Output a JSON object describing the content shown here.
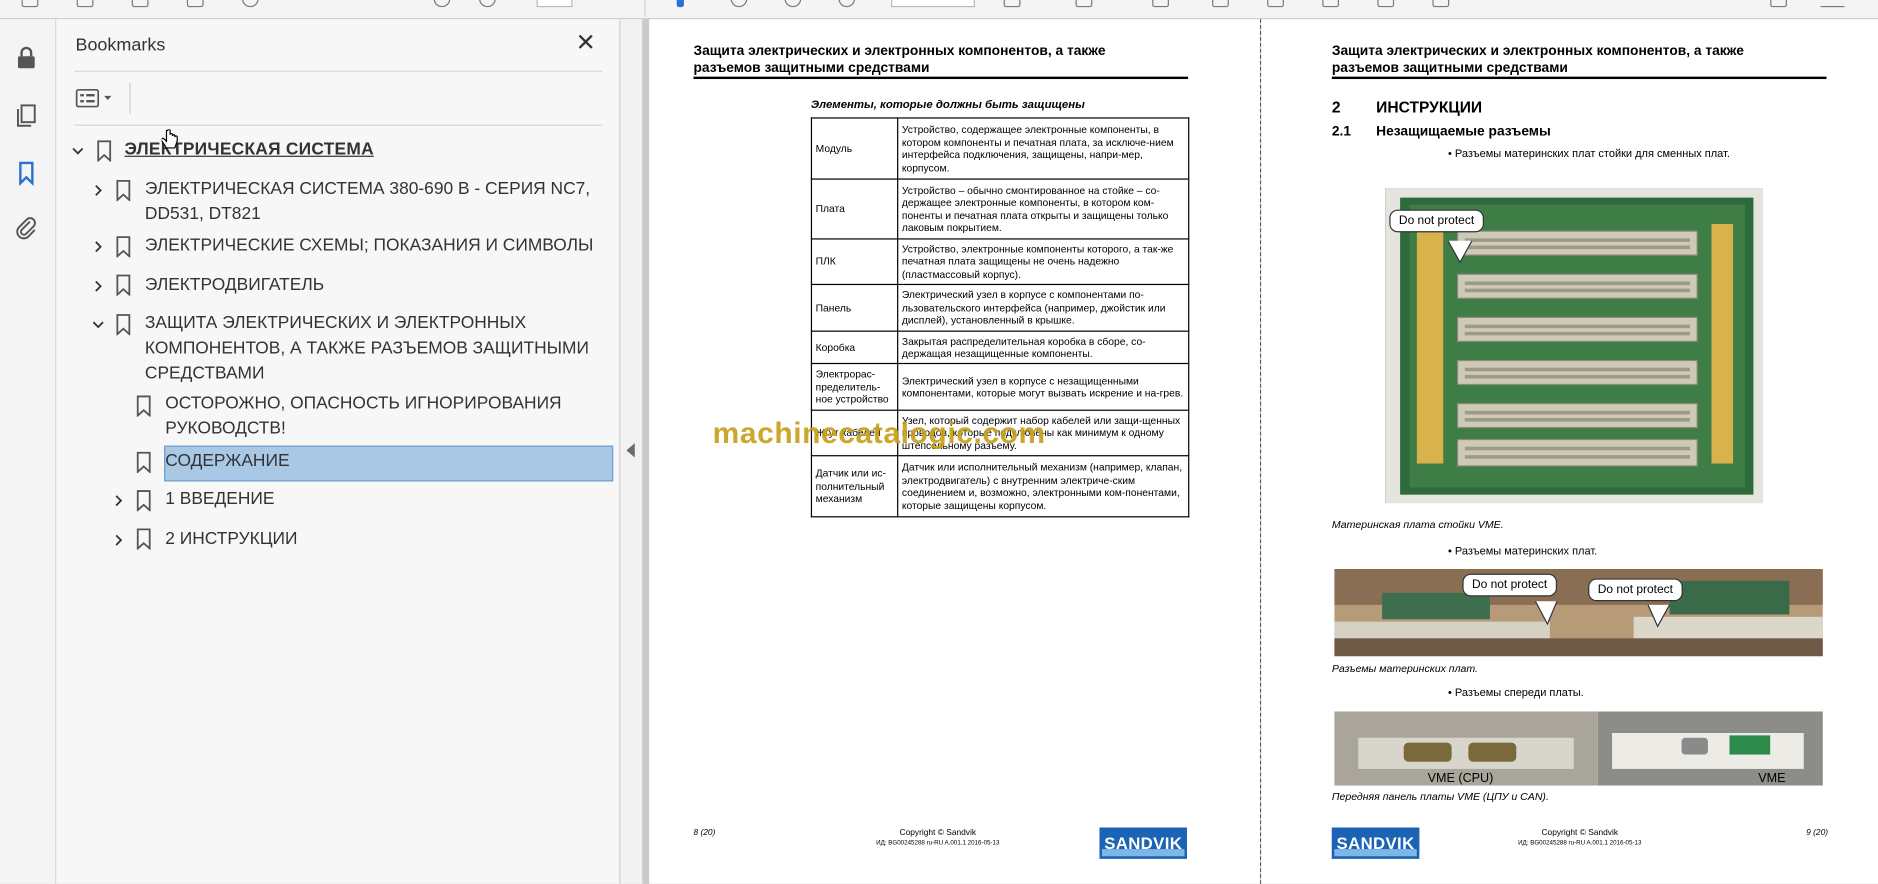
{
  "panel": {
    "title": "Bookmarks",
    "close_glyph": "✕"
  },
  "rail": {
    "icons": [
      "lock-icon",
      "pages-icon",
      "bookmark-icon",
      "attachment-icon"
    ]
  },
  "bookmarks": {
    "root": "ЭЛЕКТРИЧЕСКАЯ СИСТЕМА",
    "items": [
      {
        "line1": "ЭЛЕКТРИЧЕСКАЯ СИСТЕМА 380-690 В - СЕРИЯ NC7,",
        "line2": "DD531, DT821"
      },
      {
        "line1": "ЭЛЕКТРИЧЕСКИЕ СХЕМЫ; ПОКАЗАНИЯ И СИМВОЛЫ"
      },
      {
        "line1": "ЭЛЕКТРОДВИГАТЕЛЬ"
      },
      {
        "line1": "ЗАЩИТА ЭЛЕКТРИЧЕСКИХ И ЭЛЕКТРОННЫХ",
        "line2": "КОМПОНЕНТОВ, А ТАКЖЕ РАЗЪЕМОВ ЗАЩИТНЫМИ",
        "line3": "СРЕДСТВАМИ"
      }
    ],
    "children": [
      {
        "line1": "ОСТОРОЖНО, ОПАСНОСТЬ ИГНОРИРОВАНИЯ",
        "line2": "РУКОВОДСТВ!"
      },
      {
        "line1": "СОДЕРЖАНИЕ"
      },
      {
        "line1": "1 ВВЕДЕНИЕ"
      },
      {
        "line1": "2 ИНСТРУКЦИИ"
      }
    ]
  },
  "page_left": {
    "header_line1": "Защита электрических и электронных компонентов, а также",
    "header_line2": "разъемов защитными средствами",
    "table_caption": "Элементы, которые должны быть защищены",
    "rows": [
      {
        "k": "Модуль",
        "v": "Устройство, содержащее электронные компоненты, в котором компоненты и печатная плата, за исключе-нием интерфейса подключения, защищены, напри-мер, корпусом."
      },
      {
        "k": "Плата",
        "v": "Устройство – обычно смонтированное на стойке – со-держащее электронные компоненты, в котором ком-поненты и печатная плата открыты и защищены только лаковым покрытием."
      },
      {
        "k": "ПЛК",
        "v": "Устройство, электронные компоненты которого, а так-же печатная плата защищены не очень надежно (пластмассовый корпус)."
      },
      {
        "k": "Панель",
        "v": "Электрический узел в корпусе с компонентами по-льзовательского интерфейса (например, джойстик или дисплей), установленный в крышке."
      },
      {
        "k": "Коробка",
        "v": "Закрытая распределительная коробка в сборе, со-держащая незащищенные компоненты."
      },
      {
        "k": "Электрорас-пределитель-ное устройство",
        "v": "Электрический узел в корпусе с незащищенными компонентами, которые могут вызвать искрение и на-грев."
      },
      {
        "k": "Жгут кабелей",
        "v": "Узел, который содержит набор кабелей или защи-щенных проводов, которые подключены как минимум к одному штепсельному разъему."
      },
      {
        "k": "Датчик или ис-полнительный механизм",
        "v": "Датчик или исполнительный механизм (например, клапан, электродвигатель) с внутренним электриче-ским соединением и, возможно, электронными ком-понентами, которые защищены корпусом."
      }
    ],
    "page_no": "8 (20)",
    "copyright": "Copyright © Sandvik",
    "doc_id": "ИД: BG00245288 ru-RU A.001.1 2016-05-13",
    "brand": "SANDVIK"
  },
  "page_right": {
    "header_line1": "Защита электрических и электронных компонентов, а также",
    "header_line2": "разъемов защитными средствами",
    "section_no": "2",
    "section_title": "ИНСТРУКЦИИ",
    "sub_no": "2.1",
    "sub_title": "Незащищаемые разъемы",
    "bullet1": "•  Разъемы материнских плат стойки для сменных плат.",
    "callout": "Do not protect",
    "caption1": "Материнская плата стойки VME.",
    "bullet2": "•  Разъемы материнских плат.",
    "caption2": "Разъемы материнских плат.",
    "bullet3": "•  Разъемы спереди платы.",
    "label_cpu": "VME (CPU)",
    "label_can": "VME (CAN)",
    "caption3": "Передняя панель платы VME (ЦПУ и CAN).",
    "page_no": "9 (20)",
    "copyright": "Copyright © Sandvik",
    "doc_id": "ИД: BG00245288 ru-RU A.001.1 2016-05-13",
    "brand": "SANDVIK"
  },
  "watermark": "machinecatalogic.com",
  "colors": {
    "selection": "#a9c8e6",
    "brand": "#1a63b5",
    "watermark": "#c8a01a",
    "bookmark_active": "#2a6fd6"
  }
}
